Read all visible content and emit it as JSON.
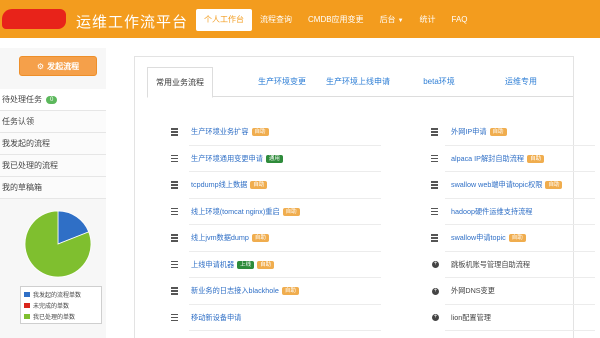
{
  "header": {
    "app_title": "运维工作流平台",
    "nav": [
      {
        "label": "个人工作台",
        "active": true
      },
      {
        "label": "流程查询"
      },
      {
        "label": "CMDB应用变更"
      },
      {
        "label": "后台",
        "dropdown": true
      },
      {
        "label": "统计"
      },
      {
        "label": "FAQ"
      }
    ]
  },
  "sidebar": {
    "start_button": "发起流程",
    "items": [
      {
        "label": "待处理任务",
        "badge": "0"
      },
      {
        "label": "任务认领"
      },
      {
        "label": "我发起的流程"
      },
      {
        "label": "我已处理的流程"
      },
      {
        "label": "我的草稿箱"
      }
    ],
    "pie": {
      "slices": [
        {
          "name": "我发起的流程单数",
          "fraction": 0.19,
          "color": "#2f6fc6"
        },
        {
          "name": "未完成的单数",
          "fraction": 0.0,
          "color": "#d9261c"
        },
        {
          "name": "我已处理的单数",
          "fraction": 0.81,
          "color": "#7fbf2f"
        }
      ]
    }
  },
  "tabs": [
    {
      "label": "常用业务流程",
      "active": true
    },
    {
      "label": "生产环境变更"
    },
    {
      "label": "生产环境上线申请"
    },
    {
      "label": "beta环境"
    },
    {
      "label": "运维专用"
    }
  ],
  "left_items": [
    {
      "label": "生产环境业务扩容",
      "tag": "自助",
      "tag_color": "orange"
    },
    {
      "label": "生产环境通用变更申请",
      "tag": "通用",
      "tag_color": "green"
    },
    {
      "label": "tcpdump线上数据",
      "tag": "自助",
      "tag_color": "orange"
    },
    {
      "label": "线上环境(tomcat nginx)重启",
      "tag": "自助",
      "tag_color": "orange"
    },
    {
      "label": "线上jvm数据dump",
      "tag": "自助",
      "tag_color": "orange"
    },
    {
      "label": "上线申请机器",
      "tag": "上线",
      "tag_color": "green",
      "tag2": "自助",
      "tag2_color": "orange"
    },
    {
      "label": "新业务的日志接入blackhole",
      "tag": "自助",
      "tag_color": "orange"
    },
    {
      "label": "移动新设备申请"
    }
  ],
  "right_items": [
    {
      "label": "外网IP申请",
      "tag": "自助",
      "tag_color": "orange",
      "icon": "list"
    },
    {
      "label": "alpaca IP解封自助流程",
      "tag": "自助",
      "tag_color": "orange",
      "icon": "list"
    },
    {
      "label": "swallow web端申请topic权限",
      "tag": "自助",
      "tag_color": "orange",
      "icon": "list"
    },
    {
      "label": "hadoop硬件运维支持流程",
      "icon": "list"
    },
    {
      "label": "swallow申请topic",
      "tag": "自助",
      "tag_color": "orange",
      "icon": "list"
    },
    {
      "label": "跳板机账号管理自助流程",
      "icon": "plus"
    },
    {
      "label": "外网DNS变更",
      "icon": "plus"
    },
    {
      "label": "lion配置管理",
      "icon": "plus"
    }
  ]
}
